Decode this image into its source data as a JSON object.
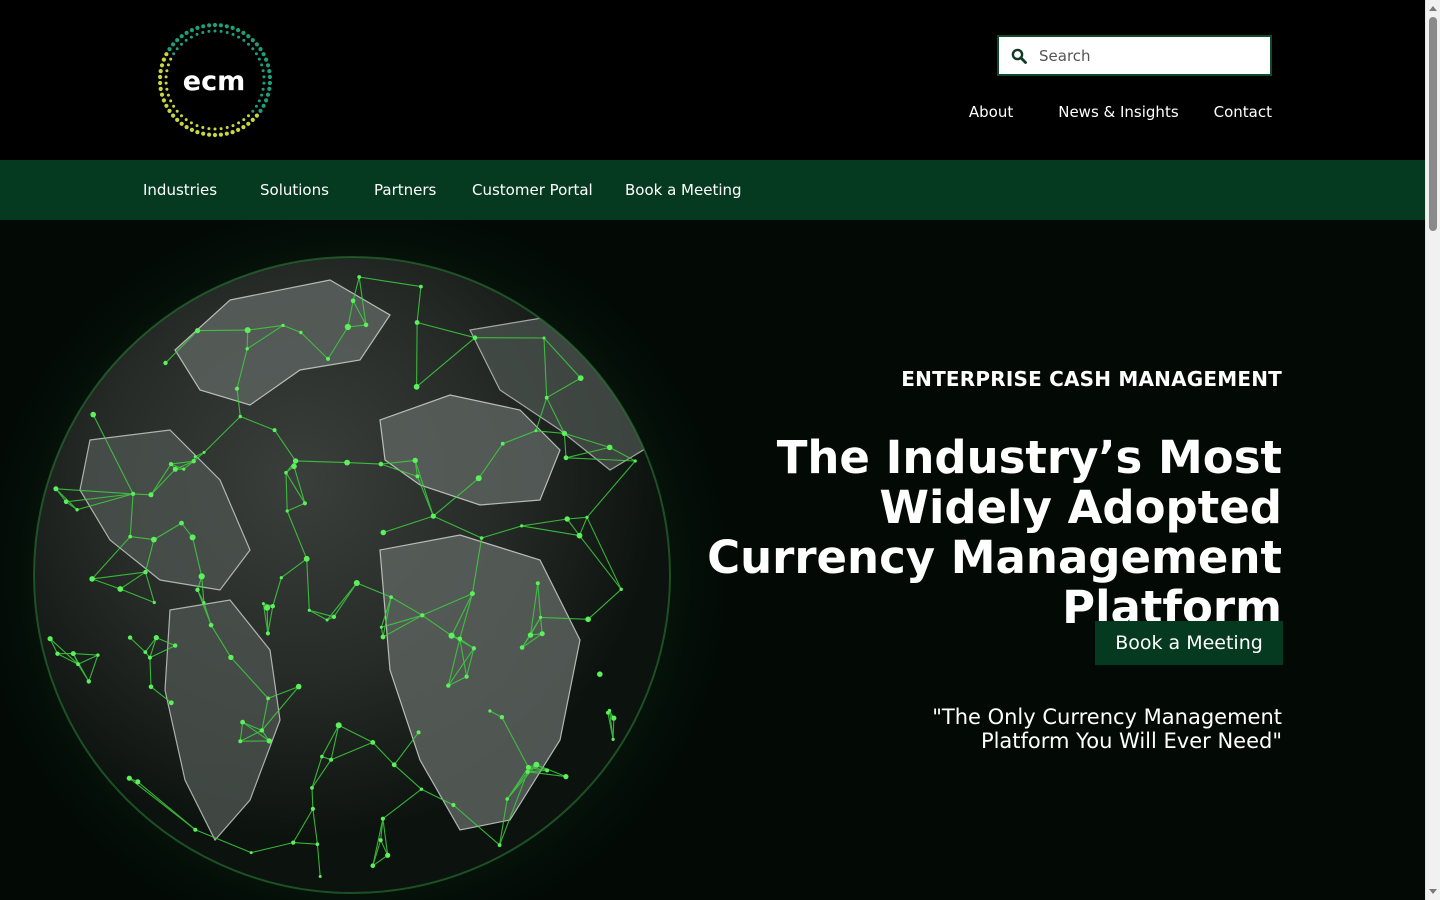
{
  "brand": {
    "logo_text": "ecm"
  },
  "search": {
    "placeholder": "Search",
    "value": ""
  },
  "utility_nav": {
    "items": [
      {
        "label": "About"
      },
      {
        "label": "News & Insights"
      },
      {
        "label": "Contact"
      }
    ]
  },
  "main_nav": {
    "items": [
      {
        "label": "Industries"
      },
      {
        "label": "Solutions"
      },
      {
        "label": "Partners"
      },
      {
        "label": "Customer Portal"
      },
      {
        "label": "Book a Meeting"
      }
    ]
  },
  "hero": {
    "eyebrow": "ENTERPRISE CASH MANAGEMENT",
    "title": "The Industry’s Most Widely Adopted Currency Management Platform",
    "cta_label": "Book a Meeting",
    "quote": "\"The Only Currency Management Platform You Will Ever Need\""
  },
  "colors": {
    "header_bg": "#000000",
    "nav_bg": "#053a20",
    "hero_bg": "#030a06",
    "accent_green": "#3fcf3f",
    "logo_teal": "#1f9e7a",
    "logo_yellow": "#c8d640"
  },
  "icons": {
    "search": "search-icon",
    "logo": "ecm-logo"
  }
}
